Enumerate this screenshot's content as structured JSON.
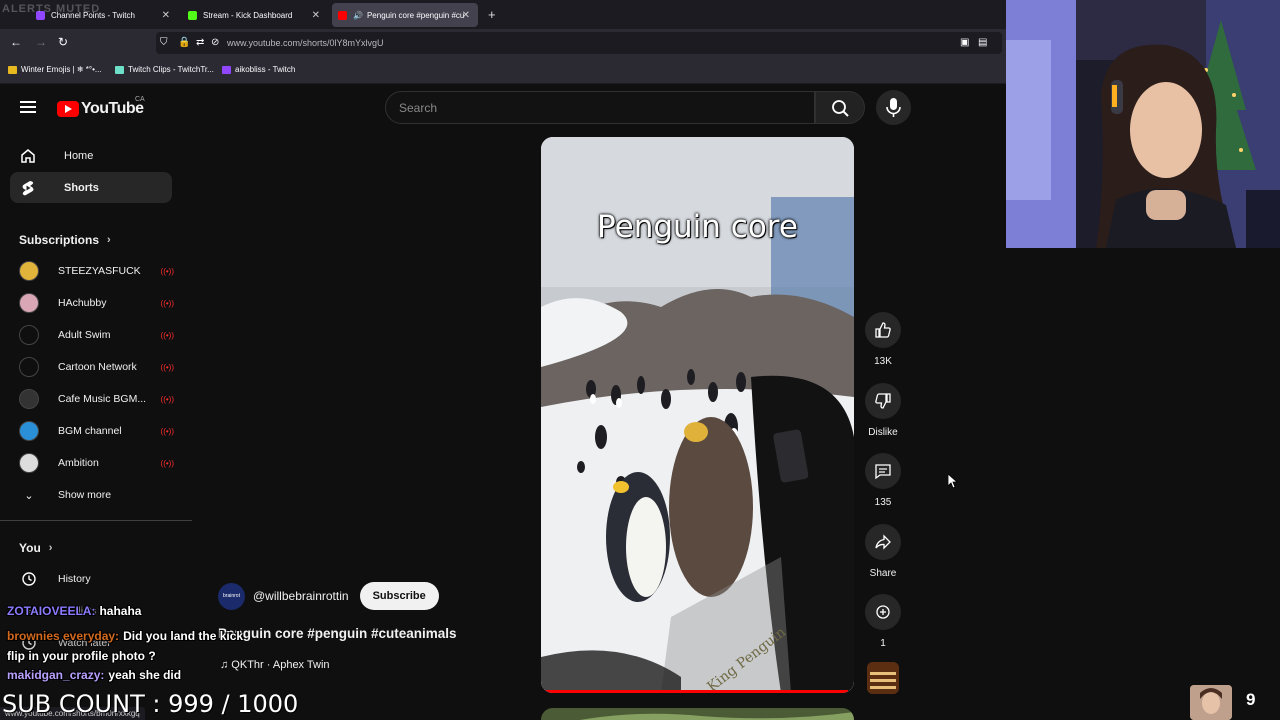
{
  "overlay": {
    "alerts_muted": "ALERTS MUTED",
    "sub_count": "SUB COUNT : 999 / 1000",
    "viewer_count": "9",
    "chat": [
      {
        "user": "ZOTAIOVEELA:",
        "message": "hahaha",
        "color": "#8a7bff"
      },
      {
        "user": "brownies everyday:",
        "message": "Did you land the kick flip in your profile photo ?",
        "color": "#d2691e"
      },
      {
        "user": "makidgan_crazy:",
        "message": "yeah she did",
        "color": "#b8a0ff"
      }
    ]
  },
  "browser": {
    "tabs": [
      {
        "label": "Channel Points - Twitch",
        "color": "#9146ff"
      },
      {
        "label": "Stream - Kick Dashboard",
        "color": "#53fc18"
      },
      {
        "label": "Penguin core #penguin #cu",
        "color": "#ff0000"
      }
    ],
    "url": "www.youtube.com/shorts/0lY8mYxlvgU",
    "bookmarks": [
      "Winter Emojis | ❄ *°•...",
      "Twitch Clips - TwitchTr...",
      "aikobliss - Twitch"
    ],
    "status_url": "www.youtube.com/shorts/bm0nrxxkgq"
  },
  "youtube": {
    "logo_text": "YouTube",
    "country": "CA",
    "search_placeholder": "Search",
    "nav": [
      {
        "label": "Home",
        "icon": "home-icon"
      },
      {
        "label": "Shorts",
        "icon": "shorts-icon"
      }
    ],
    "subscriptions_header": "Subscriptions",
    "subscriptions": [
      {
        "name": "STEEZYASFUCK",
        "color": "#e0b43a"
      },
      {
        "name": "HAchubby",
        "color": "#d9a6b5"
      },
      {
        "name": "Adult Swim",
        "color": "#0f0f0f"
      },
      {
        "name": "Cartoon Network",
        "color": "#0f0f0f"
      },
      {
        "name": "Cafe Music BGM...",
        "color": "#333333"
      },
      {
        "name": "BGM channel",
        "color": "#2a8fd6"
      },
      {
        "name": "Ambition",
        "color": "#dddddd"
      }
    ],
    "show_more": "Show more",
    "you_header": "You",
    "you_items": [
      "History",
      "Playlists",
      "Watch later"
    ],
    "short": {
      "overlay_title": "Penguin core",
      "channel": "@willbebrainrottin",
      "channel_avatar_text": "brainrot",
      "subscribe": "Subscribe",
      "title": "Penguin core #penguin #cuteanimals",
      "music": "♫ QKThr · Aphex Twin",
      "watermark": "King Penguin",
      "progress_fraction": 0.98
    },
    "actions": [
      {
        "label": "13K",
        "icon": "thumbs-up-icon"
      },
      {
        "label": "Dislike",
        "icon": "thumbs-down-icon"
      },
      {
        "label": "135",
        "icon": "comment-icon"
      },
      {
        "label": "Share",
        "icon": "share-icon"
      },
      {
        "label": "1",
        "icon": "remix-icon"
      }
    ]
  }
}
